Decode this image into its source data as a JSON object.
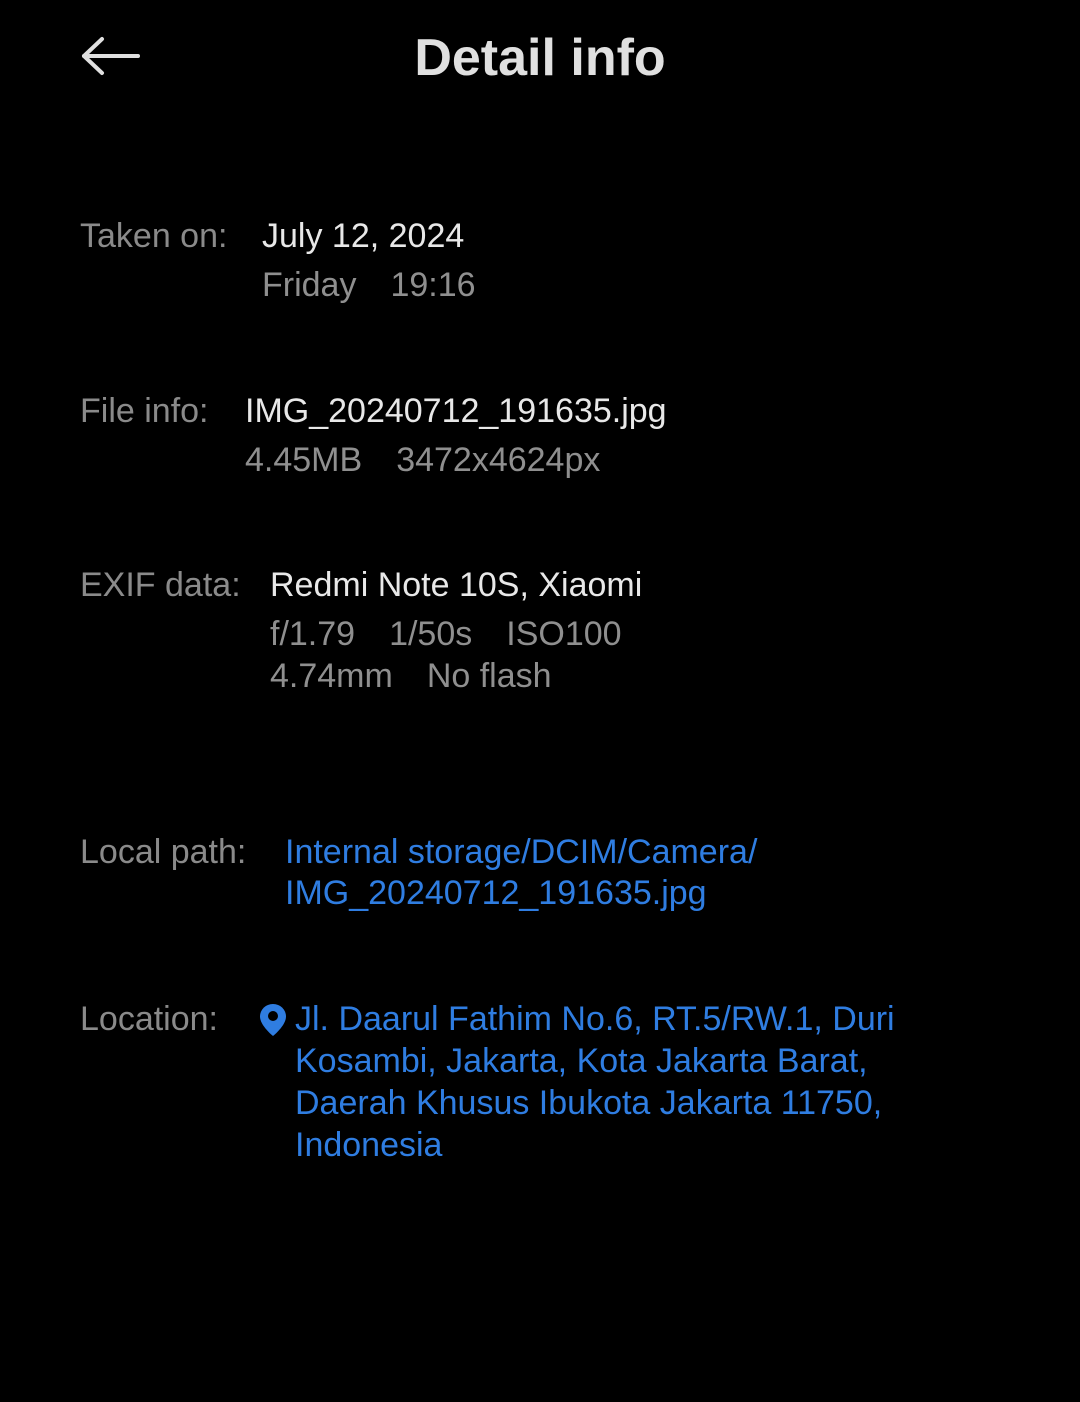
{
  "header": {
    "title": "Detail info",
    "back_icon": "arrow-left-icon"
  },
  "taken_on": {
    "label": "Taken on:",
    "date": "July 12, 2024",
    "day": "Friday",
    "time": "19:16"
  },
  "file_info": {
    "label": "File info:",
    "filename": "IMG_20240712_191635.jpg",
    "size": "4.45MB",
    "resolution": "3472x4624px"
  },
  "exif": {
    "label": "EXIF data:",
    "device": "Redmi Note 10S, Xiaomi",
    "aperture": "f/1.79",
    "shutter": "1/50s",
    "iso": "ISO100",
    "focal_length": "4.74mm",
    "flash": "No flash"
  },
  "local_path": {
    "label": "Local path:",
    "line1": "Internal storage/DCIM/Camera/",
    "line2": "IMG_20240712_191635.jpg"
  },
  "location": {
    "label": "Location:",
    "icon": "location-pin-icon",
    "line1": "Jl. Daarul Fathim No.6, RT.5/RW.1, Duri",
    "line2": "Kosambi, Jakarta, Kota Jakarta Barat,",
    "line3": "Daerah Khusus Ibukota Jakarta 11750,",
    "line4": "Indonesia"
  },
  "colors": {
    "background": "#000000",
    "link": "#2f7de1",
    "label": "#8a8a8a",
    "primary_text": "#e8e8e8"
  }
}
